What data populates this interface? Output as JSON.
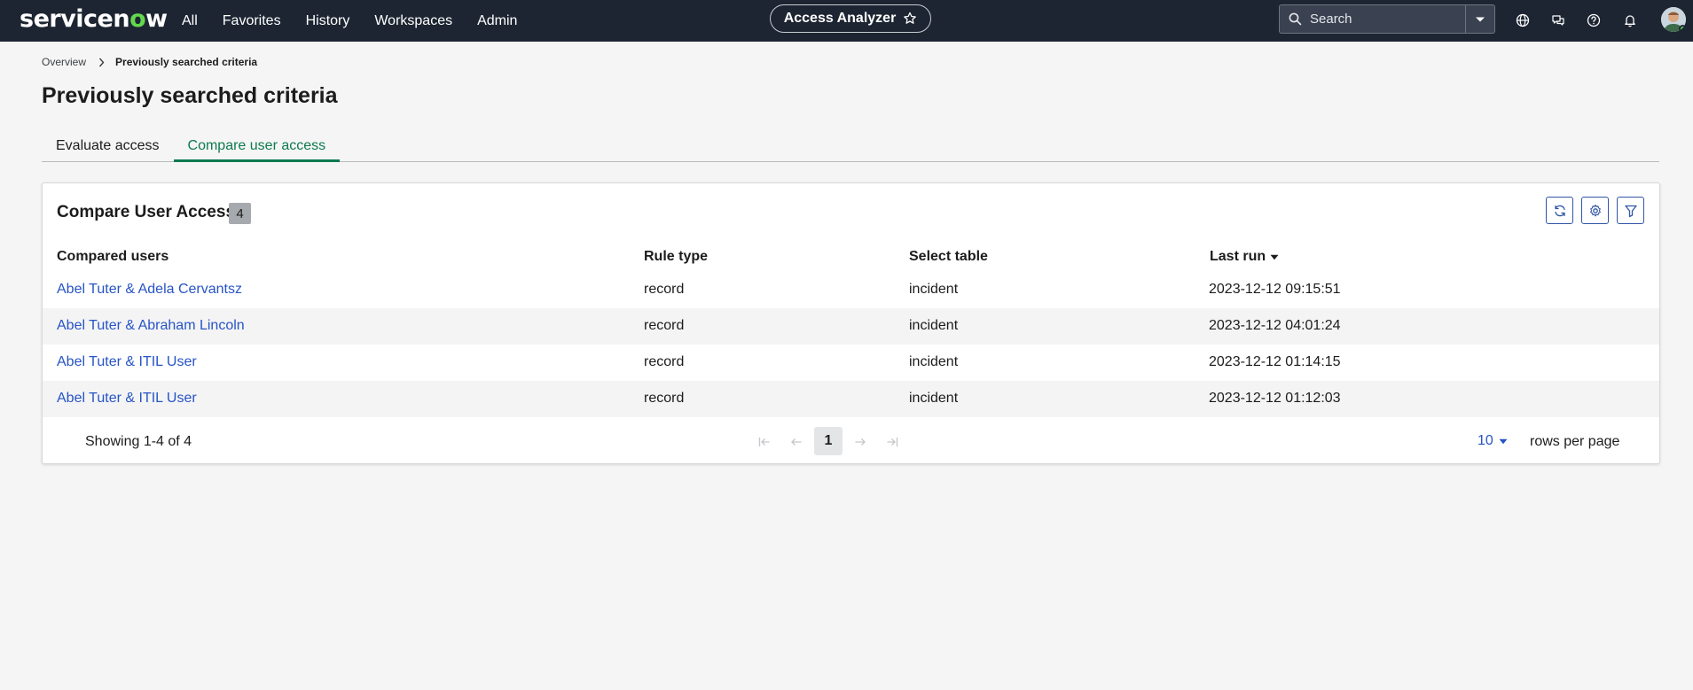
{
  "nav": {
    "logo_prefix": "servicen",
    "logo_o": "o",
    "logo_suffix": "w",
    "items": [
      "All",
      "Favorites",
      "History",
      "Workspaces",
      "Admin"
    ],
    "app_name": "Access Analyzer",
    "search_placeholder": "Search",
    "icons": [
      "globe-icon",
      "chat-icon",
      "help-icon",
      "bell-icon"
    ]
  },
  "breadcrumb": {
    "root": "Overview",
    "current": "Previously searched criteria"
  },
  "page": {
    "title": "Previously searched criteria"
  },
  "tabs": [
    {
      "label": "Evaluate access",
      "active": false
    },
    {
      "label": "Compare user access",
      "active": true
    }
  ],
  "card": {
    "title": "Compare User Access",
    "count": "4",
    "tools": [
      "refresh-icon",
      "settings-icon",
      "filter-icon"
    ]
  },
  "table": {
    "columns": [
      "Compared users",
      "Rule type",
      "Select table",
      "Last run"
    ],
    "sort_column": "Last run",
    "sort_direction": "descending",
    "rows": [
      {
        "users": "Abel Tuter & Adela Cervantsz",
        "rule_type": "record",
        "table": "incident",
        "last_run": "2023-12-12 09:15:51"
      },
      {
        "users": "Abel Tuter & Abraham Lincoln",
        "rule_type": "record",
        "table": "incident",
        "last_run": "2023-12-12 04:01:24"
      },
      {
        "users": "Abel Tuter & ITIL User",
        "rule_type": "record",
        "table": "incident",
        "last_run": "2023-12-12 01:14:15"
      },
      {
        "users": "Abel Tuter & ITIL User",
        "rule_type": "record",
        "table": "incident",
        "last_run": "2023-12-12 01:12:03"
      }
    ]
  },
  "pagination": {
    "showing": "Showing 1-4 of 4",
    "current_page": "1",
    "rows_per_page": "10",
    "rows_per_page_label": "rows per page"
  },
  "colors": {
    "nav_bg": "#1d2532",
    "accent_green": "#0d7a4f",
    "link_blue": "#2754c5",
    "logo_green": "#62d84e"
  }
}
